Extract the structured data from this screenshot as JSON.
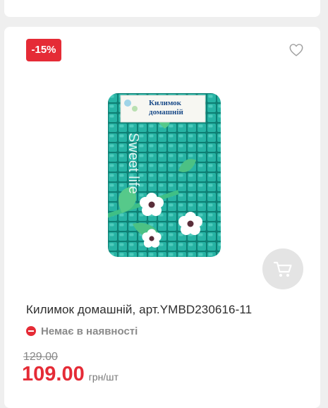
{
  "product": {
    "discount_badge": "-15%",
    "title": "Килимок домашній, арт.YMBD230616-11",
    "stock_status": "Немає в наявності",
    "old_price": "129.00",
    "new_price": "109.00",
    "unit": "грн/шт",
    "image_label_line1": "Килимок",
    "image_label_line2": "домашній",
    "image_brand_text": "Sweet life"
  },
  "icons": {
    "favorite": "heart-outline-icon",
    "cart": "shopping-cart-icon",
    "stock": "minus-circle-icon"
  },
  "colors": {
    "accent": "#e52b36",
    "mat_teal": "#1fa99a",
    "cart_button_bg": "#e4e4e4"
  }
}
